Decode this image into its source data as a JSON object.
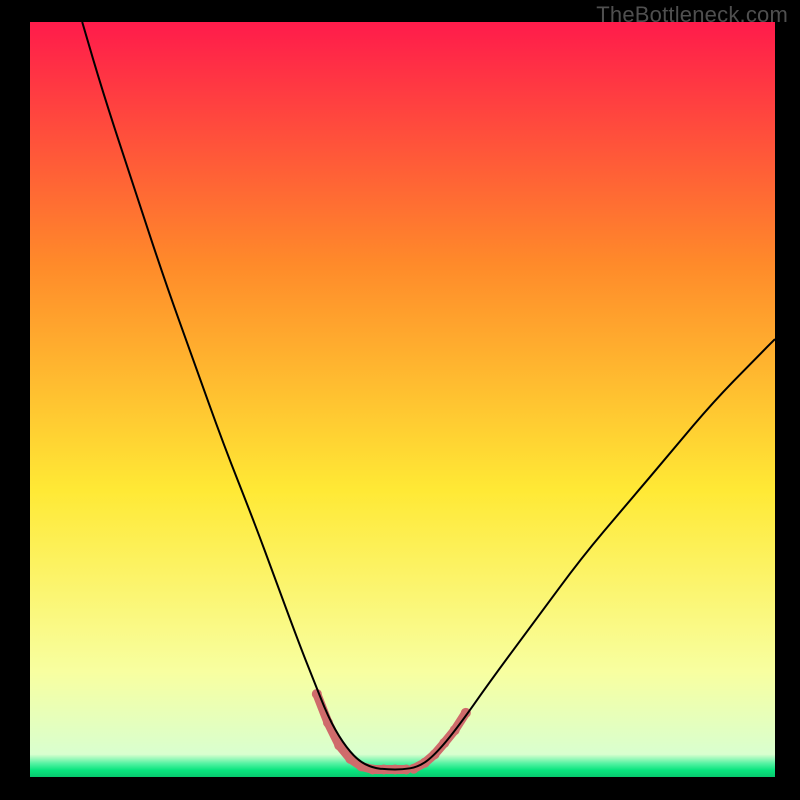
{
  "watermark": "TheBottleneck.com",
  "chart_data": {
    "type": "line",
    "title": "",
    "xlabel": "",
    "ylabel": "",
    "xlim": [
      0,
      100
    ],
    "ylim": [
      0,
      100
    ],
    "grid": false,
    "legend": false,
    "background_gradient": {
      "top_color": "#ff1b4b",
      "upper_mid_color": "#ff8a2a",
      "mid_color": "#ffe935",
      "lower_color": "#f8ffa0",
      "bottom_accent_color": "#08e57e"
    },
    "series": [
      {
        "name": "bottleneck-curve",
        "stroke": "#000000",
        "stroke_width": 2,
        "x": [
          7,
          10,
          14,
          18,
          22,
          26,
          30,
          33,
          36,
          38,
          40,
          42,
          44,
          46,
          48,
          50,
          52,
          54,
          57,
          62,
          68,
          74,
          80,
          86,
          92,
          98,
          100
        ],
        "y": [
          100,
          90,
          78,
          66,
          55,
          44,
          34,
          26,
          18,
          13,
          8,
          4.5,
          2.2,
          1.2,
          1.0,
          1.0,
          1.3,
          2.6,
          6,
          13,
          21,
          29,
          36,
          43,
          50,
          56,
          58
        ]
      }
    ],
    "highlight_segments": [
      {
        "name": "left-dip-dots",
        "color": "#cf6b6b",
        "stroke_width": 9,
        "x": [
          38.5,
          40,
          41.5,
          43,
          44.5,
          46,
          47.5,
          49,
          50.5
        ],
        "y": [
          11,
          7.2,
          4.2,
          2.4,
          1.4,
          1.0,
          1.0,
          1.0,
          1.0
        ]
      },
      {
        "name": "right-dip-dots",
        "color": "#cf6b6b",
        "stroke_width": 9,
        "x": [
          51.5,
          53,
          54.3,
          55.6,
          57,
          58.5
        ],
        "y": [
          1.1,
          1.9,
          3.0,
          4.5,
          6.2,
          8.5
        ]
      }
    ]
  }
}
